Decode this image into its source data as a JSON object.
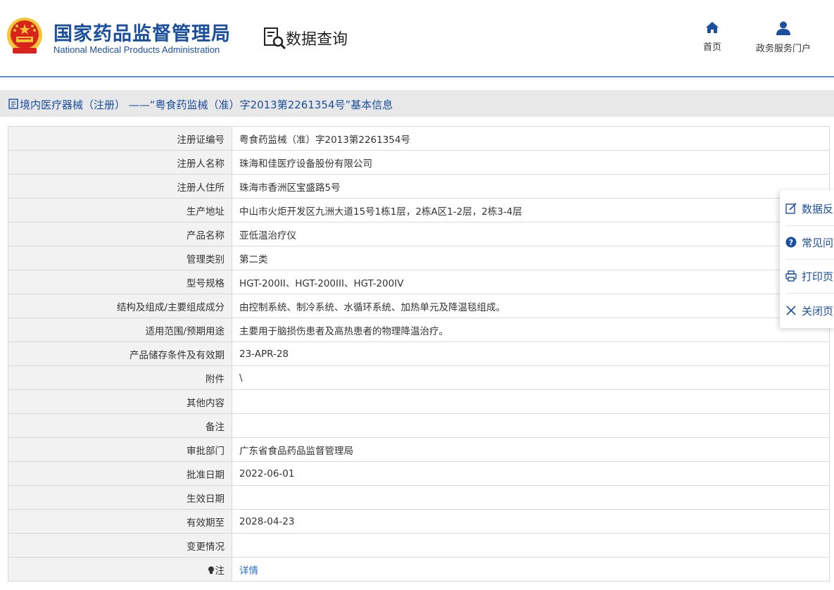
{
  "header": {
    "brand_cn": "国家药品监督管理局",
    "brand_en": "National Medical Products Administration",
    "query_title": "数据查询",
    "nav": [
      {
        "label": "首页",
        "icon": "home-icon"
      },
      {
        "label": "政务服务门户",
        "icon": "user-icon"
      }
    ]
  },
  "breadcrumb": {
    "text": "境内医疗器械（注册）  ——“粤食药监械（准）字2013第2261354号”基本信息"
  },
  "rows": [
    {
      "label": "注册证编号",
      "value": "粤食药监械（准）字2013第2261354号"
    },
    {
      "label": "注册人名称",
      "value": "珠海和佳医疗设备股份有限公司"
    },
    {
      "label": "注册人住所",
      "value": "珠海市香洲区宝盛路5号"
    },
    {
      "label": "生产地址",
      "value": "中山市火炬开发区九洲大道15号1栋1层，2栋A区1-2层，2栋3-4层"
    },
    {
      "label": "产品名称",
      "value": "亚低温治疗仪"
    },
    {
      "label": "管理类别",
      "value": "第二类"
    },
    {
      "label": "型号规格",
      "value": "HGT-200II、HGT-200III、HGT-200IV"
    },
    {
      "label": "结构及组成/主要组成成分",
      "value": "由控制系统、制冷系统、水循环系统、加热单元及降温毯组成。"
    },
    {
      "label": "适用范围/预期用途",
      "value": "主要用于脑损伤患者及高热患者的物理降温治疗。"
    },
    {
      "label": "产品储存条件及有效期",
      "value": "23-APR-28"
    },
    {
      "label": "附件",
      "value": "\\"
    },
    {
      "label": "其他内容",
      "value": ""
    },
    {
      "label": "备注",
      "value": ""
    },
    {
      "label": "审批部门",
      "value": "广东省食品药品监督管理局"
    },
    {
      "label": "批准日期",
      "value": "2022-06-01"
    },
    {
      "label": "生效日期",
      "value": ""
    },
    {
      "label": "有效期至",
      "value": "2028-04-23"
    },
    {
      "label": "变更情况",
      "value": ""
    }
  ],
  "note_row": {
    "label": "注",
    "link": "详情"
  },
  "side_panel": {
    "items": [
      {
        "label": "数据反",
        "icon": "edit-icon"
      },
      {
        "label": "常见问",
        "icon": "question-icon"
      },
      {
        "label": "打印页",
        "icon": "print-icon"
      },
      {
        "label": "关闭页",
        "icon": "close-icon"
      }
    ]
  },
  "colors": {
    "brand": "#1b4fa0",
    "link": "#2a6fc9",
    "emblem_red": "#d7231b",
    "emblem_gold": "#f6c534"
  }
}
